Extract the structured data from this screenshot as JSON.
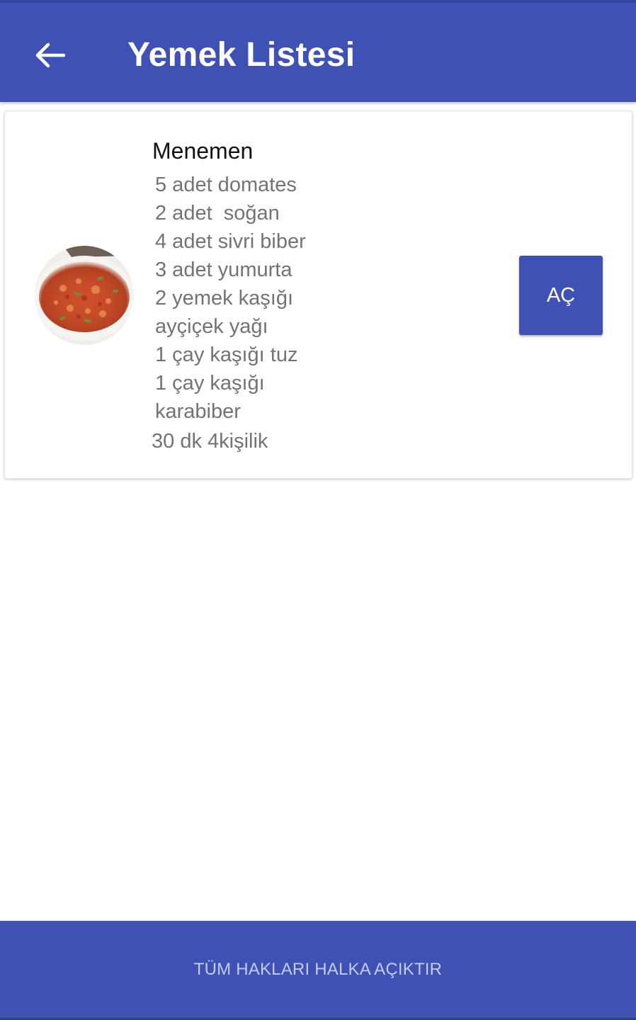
{
  "app_bar": {
    "title": "Yemek Listesi",
    "back_icon": "arrow-left-icon",
    "color": "#3f51b5"
  },
  "recipe": {
    "title": "Menemen",
    "image_icon": "menemen-dish-photo",
    "ingredients": [
      "5 adet domates",
      "2 adet  soğan",
      "4 adet sivri biber",
      "3 adet yumurta",
      "2 yemek kaşığı",
      "ayçiçek yağı",
      "1 çay kaşığı tuz",
      "1 çay kaşığı",
      "karabiber"
    ],
    "meta": "30 dk 4kişilik",
    "open_label": "AÇ"
  },
  "footer": {
    "text": "TÜM HAKLARI HALKA AÇIKTIR"
  }
}
